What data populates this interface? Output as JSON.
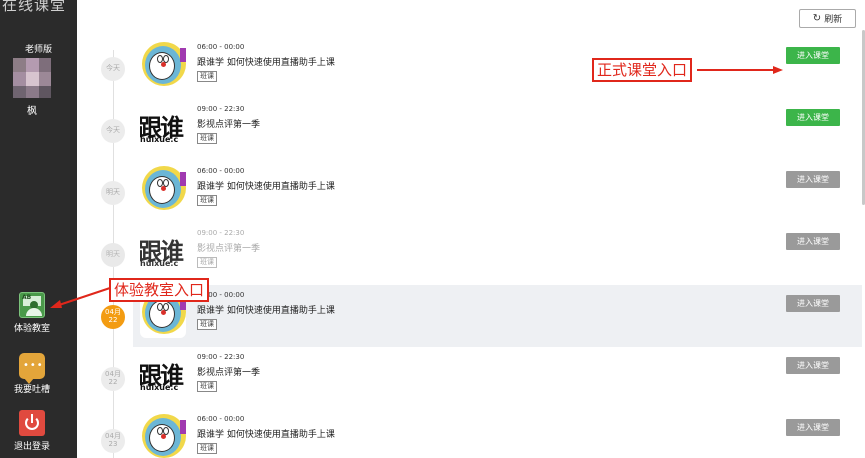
{
  "sidebar": {
    "brand": "在线课堂",
    "role": "老师版",
    "username": "枫",
    "items": [
      {
        "label": "体验教室",
        "icon": "trial-classroom-icon"
      },
      {
        "label": "我要吐槽",
        "icon": "chat-bubble-icon"
      },
      {
        "label": "退出登录",
        "icon": "power-icon"
      }
    ]
  },
  "toolbar": {
    "refresh_label": "刷新",
    "refresh_icon": "↻"
  },
  "lessons": [
    {
      "day": "今天",
      "time": "06:00 - 00:00",
      "title": "跟谁学 如何快速使用直播助手上课",
      "tag": "班课",
      "button": "进入课堂",
      "button_color": "#3cb54a",
      "thumb": "doraemon"
    },
    {
      "day": "今天",
      "time": "09:00 - 22:30",
      "title": "影视点评第一季",
      "tag": "班课",
      "button": "进入课堂",
      "button_color": "#3cb54a",
      "thumb": "genshuixue",
      "logo_big": "跟谁",
      "logo_small": "huixue.c"
    },
    {
      "day": "明天",
      "time": "06:00 - 00:00",
      "title": "跟谁学 如何快速使用直播助手上课",
      "tag": "班课",
      "button": "进入课堂",
      "button_color": "#9a9a9a",
      "thumb": "doraemon"
    },
    {
      "day": "明天",
      "time": "09:00 - 22:30",
      "title": "影视点评第一季",
      "tag": "班课",
      "button": "进入课堂",
      "button_color": "#9a9a9a",
      "thumb": "genshuixue",
      "logo_big": "跟谁",
      "logo_small": "huixue.c"
    },
    {
      "day": "04月\n22",
      "time": "06:00 - 00:00",
      "title": "跟谁学 如何快速使用直播助手上课",
      "tag": "班课",
      "button": "进入课堂",
      "button_color": "#9a9a9a",
      "thumb": "doraemon",
      "active": true
    },
    {
      "day": "04月\n22",
      "time": "09:00 - 22:30",
      "title": "影视点评第一季",
      "tag": "班课",
      "button": "进入课堂",
      "button_color": "#9a9a9a",
      "thumb": "genshuixue",
      "logo_big": "跟谁",
      "logo_small": "huixue.c"
    },
    {
      "day": "04月\n23",
      "time": "06:00 - 00:00",
      "title": "跟谁学 如何快速使用直播助手上课",
      "tag": "班课",
      "button": "进入课堂",
      "button_color": "#9a9a9a",
      "thumb": "doraemon"
    }
  ],
  "annotations": {
    "formal_entry": "正式课堂入口",
    "trial_entry": "体验教室入口"
  }
}
